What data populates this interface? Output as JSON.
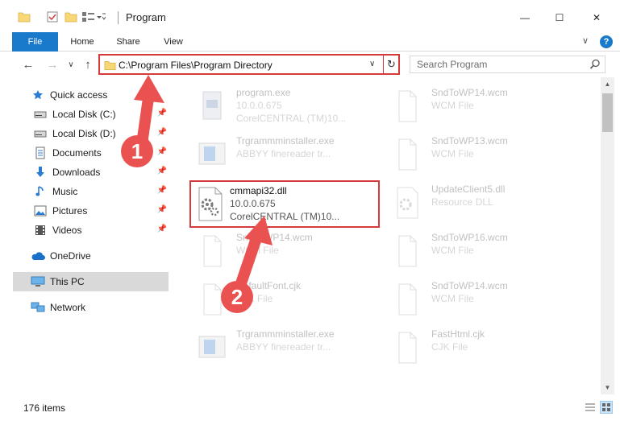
{
  "window": {
    "title": "Program",
    "minimize_glyph": "—",
    "maximize_glyph": "☐",
    "close_glyph": "✕"
  },
  "ribbon": {
    "tabs": [
      {
        "label": "File"
      },
      {
        "label": "Home"
      },
      {
        "label": "Share"
      },
      {
        "label": "View"
      }
    ],
    "help_glyph": "?",
    "chevron_glyph": "∨"
  },
  "address": {
    "path": "C:\\Program Files\\Program Directory",
    "dropdown_glyph": "∨",
    "refresh_glyph": "↻"
  },
  "nav_buttons": {
    "back_glyph": "←",
    "forward_glyph": "→",
    "recent_glyph": "∨",
    "up_glyph": "↑"
  },
  "search": {
    "placeholder": "Search Program",
    "icon": "search-icon"
  },
  "nav_pane": {
    "quick_access": "Quick access",
    "items": [
      {
        "label": "Local Disk (C:)",
        "icon": "drive-icon"
      },
      {
        "label": "Local Disk (D:)",
        "icon": "drive-icon"
      },
      {
        "label": "Documents",
        "icon": "documents-icon"
      },
      {
        "label": "Downloads",
        "icon": "downloads-icon"
      },
      {
        "label": "Music",
        "icon": "music-icon"
      },
      {
        "label": "Pictures",
        "icon": "pictures-icon"
      },
      {
        "label": "Videos",
        "icon": "videos-icon"
      }
    ],
    "pin_glyph": "📌",
    "onedrive": "OneDrive",
    "this_pc": "This PC",
    "network": "Network"
  },
  "files": [
    {
      "name": "program.exe",
      "version": "10.0.0.675",
      "desc": "CorelCENTRAL (TM)10...",
      "icon": "exe-icon"
    },
    {
      "name": "SndToWP14.wcm",
      "version": "WCM File",
      "desc": "",
      "icon": "blank-file-icon"
    },
    {
      "name": "Trgrammminstaller.exe",
      "version": "ABBYY finereader tr...",
      "desc": "",
      "icon": "installer-icon"
    },
    {
      "name": "SndToWP13.wcm",
      "version": "WCM File",
      "desc": "",
      "icon": "blank-file-icon"
    },
    {
      "name": "cmmapi32.dll",
      "version": "10.0.0.675",
      "desc": "CorelCENTRAL (TM)10...",
      "icon": "dll-icon"
    },
    {
      "name": "UpdateClient5.dll",
      "version": "Resource DLL",
      "desc": "",
      "icon": "dll-icon"
    },
    {
      "name": "SndToWP14.wcm",
      "version": "WCM File",
      "desc": "",
      "icon": "blank-file-icon"
    },
    {
      "name": "SndToWP16.wcm",
      "version": "WCM File",
      "desc": "",
      "icon": "blank-file-icon"
    },
    {
      "name": "DefaultFont.cjk",
      "version": "CJK File",
      "desc": "",
      "icon": "blank-file-icon"
    },
    {
      "name": "SndToWP14.wcm",
      "version": "WCM File",
      "desc": "",
      "icon": "blank-file-icon"
    },
    {
      "name": "Trgrammminstaller.exe",
      "version": "ABBYY finereader tr...",
      "desc": "",
      "icon": "installer-icon"
    },
    {
      "name": "FastHtml.cjk",
      "version": "CJK File",
      "desc": "",
      "icon": "blank-file-icon"
    }
  ],
  "status": {
    "count": "176 items"
  },
  "annotations": {
    "step1": "1",
    "step2": "2",
    "color": "#ea5252"
  }
}
